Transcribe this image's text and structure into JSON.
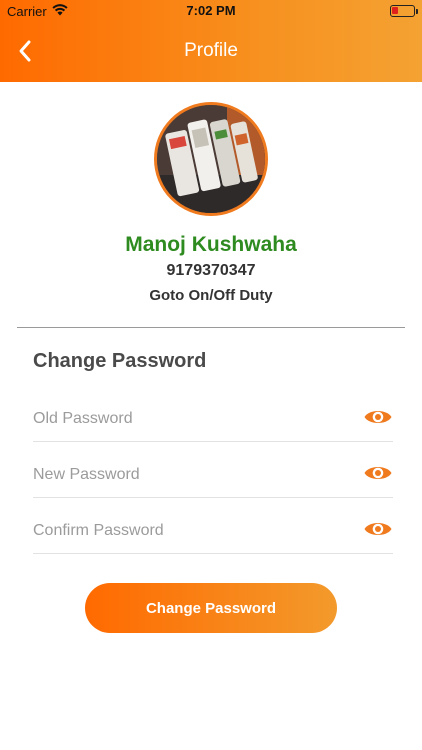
{
  "status_bar": {
    "carrier": "Carrier",
    "time": "7:02 PM"
  },
  "header": {
    "title": "Profile",
    "back_icon": "chevron-left-icon"
  },
  "profile": {
    "name": "Manoj Kushwaha",
    "phone": "9179370347",
    "duty_link": "Goto On/Off Duty"
  },
  "change_password": {
    "title": "Change Password",
    "fields": [
      {
        "placeholder": "Old Password",
        "icon": "eye-icon"
      },
      {
        "placeholder": "New Password",
        "icon": "eye-icon"
      },
      {
        "placeholder": "Confirm Password",
        "icon": "eye-icon"
      }
    ],
    "button_label": "Change Password"
  },
  "colors": {
    "accent": "#ff6a00",
    "accent_light": "#f4a233",
    "name_green": "#2e8b1f"
  }
}
